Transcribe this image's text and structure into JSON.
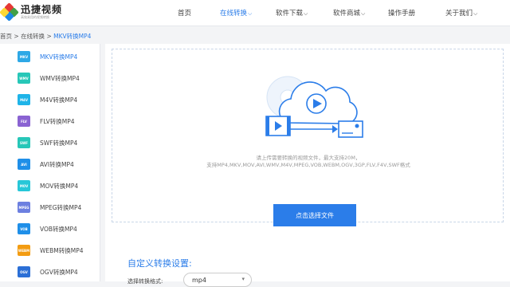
{
  "logo": {
    "title": "迅捷视频",
    "subtitle": "高效易用的视频转换",
    "colors": [
      "#e53935",
      "#43a047",
      "#1e88e5",
      "#fdd835"
    ]
  },
  "nav": {
    "items": [
      {
        "label": "首页",
        "active": false,
        "has_dropdown": false
      },
      {
        "label": "在线转换",
        "active": true,
        "has_dropdown": true
      },
      {
        "label": "软件下载",
        "active": false,
        "has_dropdown": true
      },
      {
        "label": "软件商城",
        "active": false,
        "has_dropdown": true
      },
      {
        "label": "操作手册",
        "active": false,
        "has_dropdown": false
      },
      {
        "label": "关于我们",
        "active": false,
        "has_dropdown": true
      }
    ]
  },
  "breadcrumb": {
    "home": "首页",
    "sep1": " > ",
    "section": "在线转换",
    "sep2": " > ",
    "current": "MKV转换MP4"
  },
  "sidebar": {
    "items": [
      {
        "badge": "MKV",
        "label": "MKV转换MP4",
        "color": "#2ea8e6",
        "active": true
      },
      {
        "badge": "WMV",
        "label": "WMV转换MP4",
        "color": "#27c7b8",
        "active": false
      },
      {
        "badge": "M4V",
        "label": "M4V转换MP4",
        "color": "#1fb4e8",
        "active": false
      },
      {
        "badge": "FLV",
        "label": "FLV转换MP4",
        "color": "#8a63d2",
        "active": false
      },
      {
        "badge": "SWF",
        "label": "SWF转换MP4",
        "color": "#27c7b8",
        "active": false
      },
      {
        "badge": "AVI",
        "label": "AVI转换MP4",
        "color": "#1f8fe8",
        "active": false
      },
      {
        "badge": "MOV",
        "label": "MOV转换MP4",
        "color": "#27c7d8",
        "active": false
      },
      {
        "badge": "MPEG",
        "label": "MPEG转换MP4",
        "color": "#6c7fe0",
        "active": false
      },
      {
        "badge": "VOB",
        "label": "VOB转换MP4",
        "color": "#1f8fe8",
        "active": false
      },
      {
        "badge": "WEBM",
        "label": "WEBM转换MP4",
        "color": "#f39c12",
        "active": false
      },
      {
        "badge": "OGV",
        "label": "OGV转换MP4",
        "color": "#2b6fd6",
        "active": false
      }
    ]
  },
  "upload": {
    "line1": "请上传需要转换的视频文件，最大支持20M，",
    "line2": "支持MP4,MKV,MOV,AVI,WMV,M4V,MPEG,VOB,WEBM,OGV,3GP,FLV,F4V,SWF格式",
    "button": "点击选择文件"
  },
  "settings": {
    "title": "自定义转换设置:",
    "format_label": "选择转换格式:",
    "format_value": "mp4"
  },
  "colors": {
    "accent": "#2b7de9"
  }
}
